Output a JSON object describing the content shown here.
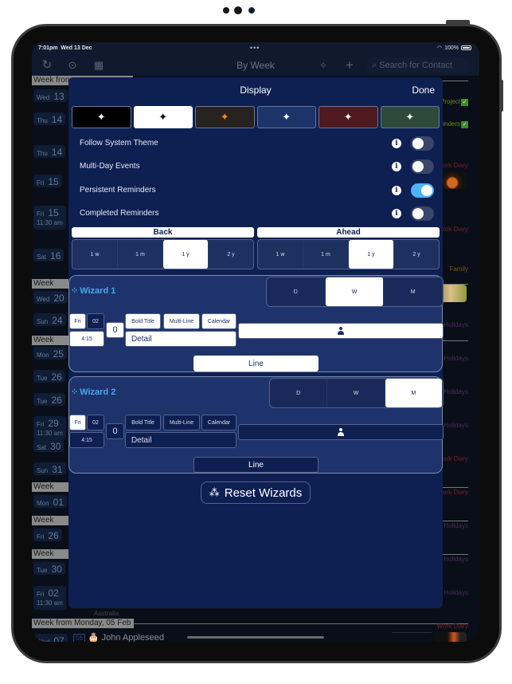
{
  "status_bar": {
    "time": "7:01pm",
    "date": "Wed 13 Dec",
    "wifi_icon": "wifi-icon",
    "battery": "100%"
  },
  "nav": {
    "title": "By Week",
    "search_placeholder": "Search for Contact",
    "icons": [
      "refresh-icon",
      "more-icon",
      "calendar-icon",
      "magic-wand-icon",
      "plus-icon",
      "search-icon"
    ]
  },
  "background_list": {
    "week_headers": [
      "Week from",
      "Week from",
      "Week from",
      "Week from",
      "Week from",
      "Week from",
      "Week from Monday, 05 Feb"
    ],
    "days": [
      {
        "dow": "Wed",
        "day": "13",
        "time": ""
      },
      {
        "dow": "Thu",
        "day": "14",
        "time": ""
      },
      {
        "dow": "Thu",
        "day": "14",
        "time": ""
      },
      {
        "dow": "Fri",
        "day": "15",
        "time": ""
      },
      {
        "dow": "Fri",
        "day": "15",
        "time": "11:30 am"
      },
      {
        "dow": "Sat",
        "day": "16",
        "time": ""
      },
      {
        "dow": "Wed",
        "day": "20",
        "time": ""
      },
      {
        "dow": "Sun",
        "day": "24",
        "time": ""
      },
      {
        "dow": "Mon",
        "day": "25",
        "time": ""
      },
      {
        "dow": "Tue",
        "day": "26",
        "time": ""
      },
      {
        "dow": "Tue",
        "day": "26",
        "time": ""
      },
      {
        "dow": "Fri",
        "day": "29",
        "time": "11:30 am"
      },
      {
        "dow": "Sat",
        "day": "30",
        "time": ""
      },
      {
        "dow": "Sun",
        "day": "31",
        "time": ""
      },
      {
        "dow": "Mon",
        "day": "01",
        "time": ""
      },
      {
        "dow": "Fri",
        "day": "26",
        "time": ""
      },
      {
        "dow": "Tue",
        "day": "30",
        "time": ""
      },
      {
        "dow": "Fri",
        "day": "02",
        "time": "11:30 am"
      },
      {
        "dow": "Wed",
        "day": "07",
        "time": ""
      }
    ],
    "right_labels": [
      {
        "text": "Project",
        "color": "#6b8a1f",
        "check": true
      },
      {
        "text": "minders",
        "color": "#6b8a1f",
        "check": true
      },
      {
        "text": "Work Diary",
        "color": "#7a1f33",
        "check": false
      },
      {
        "text": "Work Diary",
        "color": "#7a1f33",
        "check": false
      },
      {
        "text": "Family",
        "color": "#7a5a1a",
        "check": false
      },
      {
        "text": "an Holidays",
        "color": "#4a2a5e",
        "check": false
      },
      {
        "text": "an Holidays",
        "color": "#4a2a5e",
        "check": false
      },
      {
        "text": "an Holidays",
        "color": "#4a2a5e",
        "check": false
      },
      {
        "text": "an Holidays",
        "color": "#4a2a5e",
        "check": false
      },
      {
        "text": "Work Diary",
        "color": "#7a1f33",
        "check": false
      },
      {
        "text": "Work Diary",
        "color": "#7a1f33",
        "check": false
      },
      {
        "text": "an Holidays",
        "color": "#4a2a5e",
        "check": false
      },
      {
        "text": "an Holidays",
        "color": "#4a2a5e",
        "check": false
      },
      {
        "text": "an Holidays",
        "color": "#4a2a5e",
        "check": false
      },
      {
        "text": "Work Diary",
        "color": "#7a1f33",
        "check": false
      },
      {
        "text": "Work Diary",
        "color": "#7a1f33",
        "check": false
      }
    ],
    "bottom_event": {
      "badge": "56",
      "icon": "birthday-cake-icon",
      "name": "John Appleseed"
    },
    "partial_text": "Australia"
  },
  "display_modal": {
    "title": "Display",
    "done_label": "Done",
    "themes": [
      {
        "name": "black",
        "bg": "#000000",
        "star": "#ffffff",
        "selected": false
      },
      {
        "name": "white",
        "bg": "#ffffff",
        "star": "#000000",
        "selected": true
      },
      {
        "name": "dark-brown",
        "bg": "#272320",
        "star": "#f08a1c",
        "selected": false
      },
      {
        "name": "blue",
        "bg": "#1c3468",
        "star": "#ffffff",
        "selected": false
      },
      {
        "name": "maroon",
        "bg": "#4e1a20",
        "star": "#ffffff",
        "selected": false
      },
      {
        "name": "green",
        "bg": "#2e4a3a",
        "star": "#ffffff",
        "selected": false
      }
    ],
    "star_glyph": "✦",
    "settings": [
      {
        "label": "Follow System Theme",
        "on": false
      },
      {
        "label": "Multi-Day Events",
        "on": false
      },
      {
        "label": "Persistent Reminders",
        "on": true
      },
      {
        "label": "Completed Reminders",
        "on": false
      }
    ],
    "info_glyph": "i",
    "back": {
      "label": "Back",
      "options": [
        "1 w",
        "1 m",
        "1 y",
        "2 y"
      ],
      "selected": "1 y"
    },
    "ahead": {
      "label": "Ahead",
      "options": [
        "1 w",
        "1 m",
        "1 y",
        "2 y"
      ],
      "selected": "1 y"
    },
    "wizards": [
      {
        "title": "Wizard 1",
        "period_options": [
          "D",
          "W",
          "M"
        ],
        "period_selected": "W",
        "chips": {
          "dow": "Fri",
          "day": "02",
          "time": "4:15",
          "count": "0",
          "bold_title": "Bold Title",
          "multi_line": "Multi-Line",
          "calendar": "Calendar",
          "detail": "Detail",
          "line": "Line"
        },
        "style": "light"
      },
      {
        "title": "Wizard 2",
        "period_options": [
          "D",
          "W",
          "M"
        ],
        "period_selected": "M",
        "chips": {
          "dow": "Fri",
          "day": "02",
          "time": "4:15",
          "count": "0",
          "bold_title": "Bold Title",
          "multi_line": "Multi-Line",
          "calendar": "Calendar",
          "detail": "Detail",
          "line": "Line"
        },
        "style": "dark"
      }
    ],
    "reset_label": "Reset Wizards"
  }
}
